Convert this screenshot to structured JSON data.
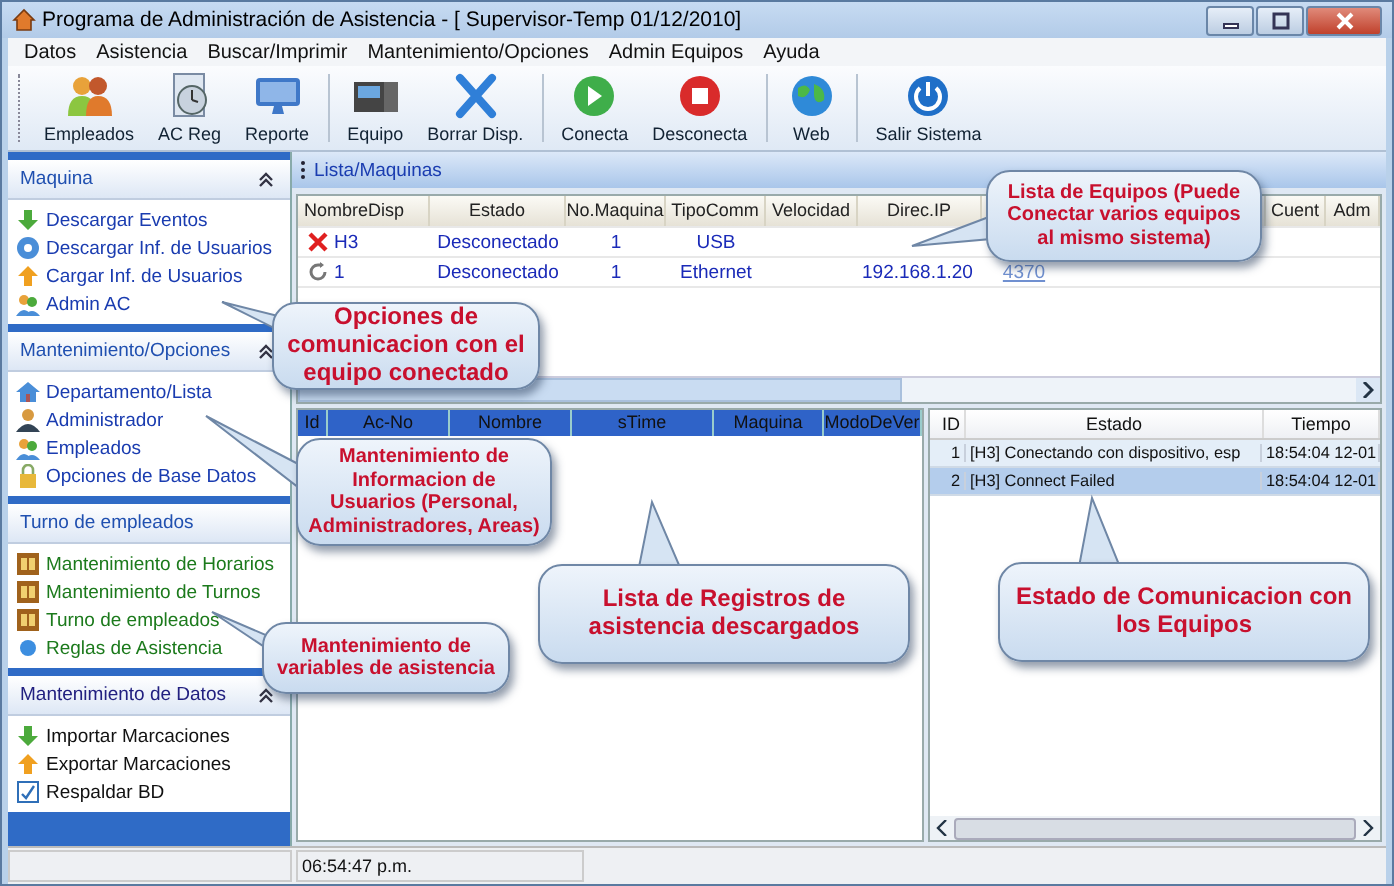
{
  "window": {
    "title": "Programa de Administración de Asistencia - [ Supervisor-Temp 01/12/2010]"
  },
  "menu": [
    "Datos",
    "Asistencia",
    "Buscar/Imprimir",
    "Mantenimiento/Opciones",
    "Admin Equipos",
    "Ayuda"
  ],
  "toolbar": [
    [
      {
        "label": "Empleados"
      },
      {
        "label": "AC Reg"
      },
      {
        "label": "Reporte"
      }
    ],
    [
      {
        "label": "Equipo"
      },
      {
        "label": "Borrar Disp."
      }
    ],
    [
      {
        "label": "Conecta"
      },
      {
        "label": "Desconecta"
      }
    ],
    [
      {
        "label": "Web"
      }
    ],
    [
      {
        "label": "Salir Sistema"
      }
    ]
  ],
  "sidebar": [
    {
      "title": "Maquina",
      "chevron": true,
      "items": [
        "Descargar Eventos",
        "Descargar Inf. de Usuarios",
        "Cargar Inf. de Usuarios",
        "Admin AC"
      ]
    },
    {
      "title": "Mantenimiento/Opciones",
      "chevron": true,
      "items": [
        "Departamento/Lista",
        "Administrador",
        "Empleados",
        "Opciones de Base Datos"
      ]
    },
    {
      "title": "Turno de empleados",
      "chevron": false,
      "items": [
        "Mantenimiento de Horarios",
        "Mantenimiento de Turnos",
        "Turno de empleados",
        "Reglas de Asistencia"
      ]
    },
    {
      "title": "Mantenimiento de Datos",
      "chevron": true,
      "items": [
        "Importar Marcaciones",
        "Exportar Marcaciones",
        "Respaldar BD"
      ]
    }
  ],
  "machines": {
    "title": "Lista/Maquinas",
    "columns": [
      {
        "label": "NombreDisp"
      },
      {
        "label": "Estado"
      },
      {
        "label": "No.Maquina"
      },
      {
        "label": "TipoComm"
      },
      {
        "label": "Velocidad"
      },
      {
        "label": "Direc.IP"
      },
      {},
      {},
      {},
      {
        "label": "Cuent"
      },
      {
        "label": "Adm"
      }
    ],
    "rows": [
      {
        "kind": "error",
        "name": "H3",
        "status": "Desconectado",
        "number": "1",
        "comm": "USB"
      },
      {
        "kind": "idle",
        "name": "1",
        "status": "Desconectado",
        "number": "1",
        "comm": "Ethernet",
        "ip": "192.168.1.20",
        "port": "4370"
      }
    ]
  },
  "records": {
    "columns": [
      "Id",
      "Ac-No",
      "Nombre",
      "sTime",
      "Maquina",
      "ModoDeVer"
    ]
  },
  "log": {
    "columns": [
      "ID",
      "Estado",
      "Tiempo"
    ],
    "rows": [
      {
        "id": "1",
        "message": "[H3] Conectando con dispositivo, esp",
        "time": "18:54:04 12-01",
        "selected": false
      },
      {
        "id": "2",
        "message": "[H3] Connect Failed",
        "time": "18:54:04 12-01",
        "selected": true
      }
    ]
  },
  "status_bar": {
    "time": "06:54:47 p.m."
  },
  "callouts": [
    {
      "text": "Opciones de comunicacion con el equipo conectado"
    },
    {
      "text": "Mantenimiento de Informacion de Usuarios (Personal, Administradores, Areas)"
    },
    {
      "text": "Mantenimiento de variables de asistencia"
    },
    {
      "text": "Lista de Equipos (Puede Conectar varios equipos al mismo sistema)"
    },
    {
      "text": "Lista de Registros de asistencia descargados"
    },
    {
      "text": "Estado de Comunicacion con los Equipos"
    }
  ]
}
